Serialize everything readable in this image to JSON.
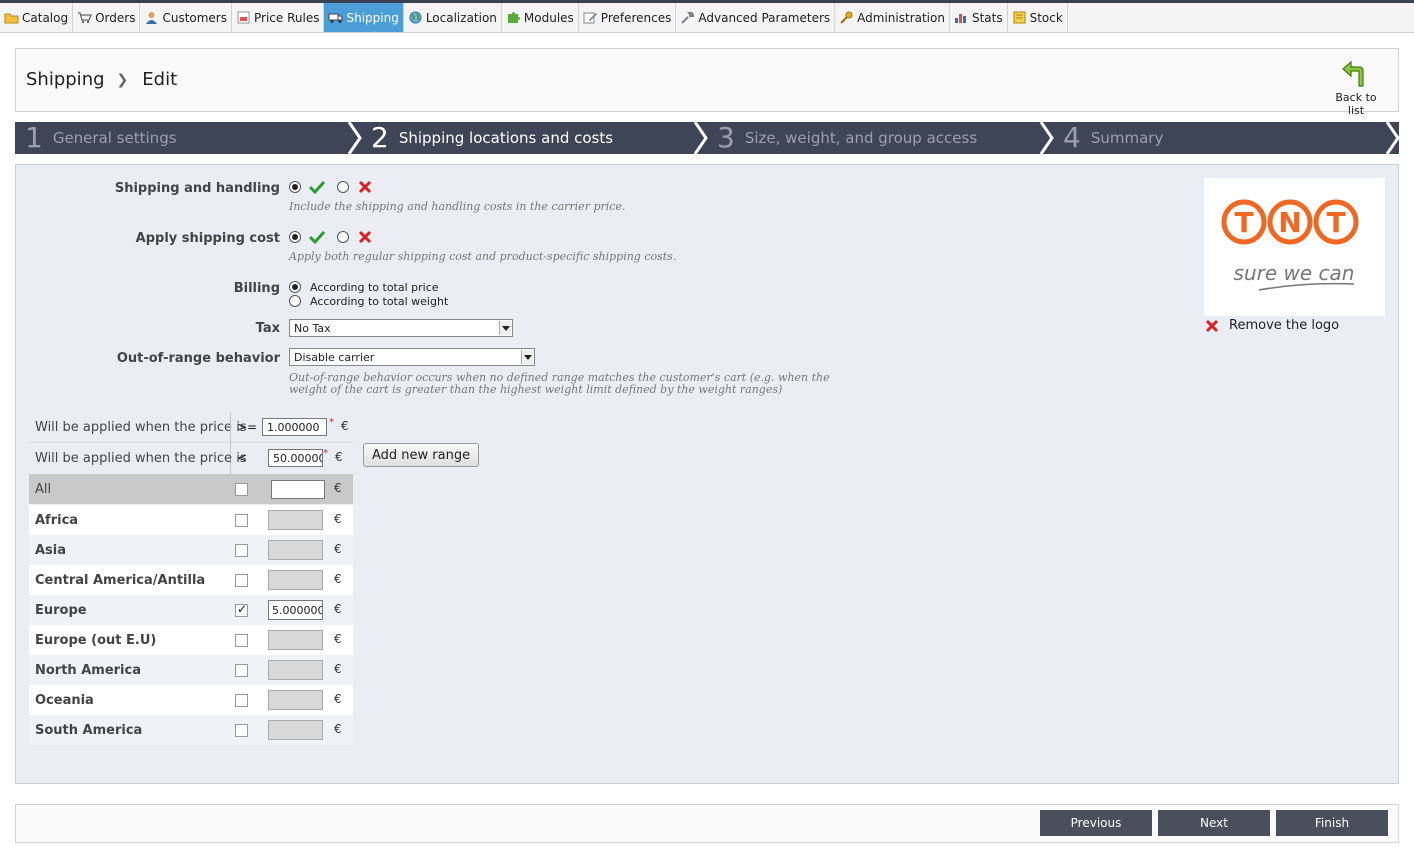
{
  "nav": [
    {
      "label": "Catalog",
      "icon": "folder-icon",
      "active": false
    },
    {
      "label": "Orders",
      "icon": "cart-icon",
      "active": false
    },
    {
      "label": "Customers",
      "icon": "person-icon",
      "active": false
    },
    {
      "label": "Price Rules",
      "icon": "price-tag-icon",
      "active": false
    },
    {
      "label": "Shipping",
      "icon": "truck-icon",
      "active": true
    },
    {
      "label": "Localization",
      "icon": "globe-icon",
      "active": false
    },
    {
      "label": "Modules",
      "icon": "puzzle-icon",
      "active": false
    },
    {
      "label": "Preferences",
      "icon": "edit-icon",
      "active": false
    },
    {
      "label": "Advanced Parameters",
      "icon": "wrench-icon",
      "active": false
    },
    {
      "label": "Administration",
      "icon": "key-icon",
      "active": false
    },
    {
      "label": "Stats",
      "icon": "bar-chart-icon",
      "active": false
    },
    {
      "label": "Stock",
      "icon": "stock-icon",
      "active": false
    }
  ],
  "header": {
    "crumb_section": "Shipping",
    "crumb_page": "Edit",
    "back_label": "Back to list"
  },
  "steps": [
    {
      "num": "1",
      "label": "General settings",
      "active": false
    },
    {
      "num": "2",
      "label": "Shipping locations and costs",
      "active": true
    },
    {
      "num": "3",
      "label": "Size, weight, and group access",
      "active": false
    },
    {
      "num": "4",
      "label": "Summary",
      "active": false
    }
  ],
  "form": {
    "shipping_handling": {
      "label": "Shipping and handling",
      "value": "yes",
      "help": "Include the shipping and handling costs in the carrier price."
    },
    "apply_shipping_cost": {
      "label": "Apply shipping cost",
      "value": "yes",
      "help": "Apply both regular shipping cost and product-specific shipping costs."
    },
    "billing": {
      "label": "Billing",
      "options": [
        "According to total price",
        "According to total weight"
      ],
      "selected": "According to total price"
    },
    "tax": {
      "label": "Tax",
      "value": "No Tax"
    },
    "out_of_range": {
      "label": "Out-of-range behavior",
      "value": "Disable carrier",
      "help_line1": "Out-of-range behavior occurs when no defined range matches the customer's cart (e.g. when the",
      "help_line2": "weight of the cart is greater than the highest weight limit defined by the weight ranges)"
    }
  },
  "logo": {
    "brand": "TNT",
    "tagline": "sure we can",
    "remove_label": "Remove the logo"
  },
  "ranges": {
    "row_label": "Will be applied when the price is",
    "op_from": ">=",
    "from_value": "1.000000",
    "op_to": "<",
    "to_value": "50.000000",
    "currency": "€",
    "add_button": "Add new range",
    "all_label": "All",
    "zones": [
      {
        "name": "Africa",
        "checked": false,
        "value": ""
      },
      {
        "name": "Asia",
        "checked": false,
        "value": ""
      },
      {
        "name": "Central America/Antilla",
        "checked": false,
        "value": ""
      },
      {
        "name": "Europe",
        "checked": true,
        "value": "5.000000"
      },
      {
        "name": "Europe (out E.U)",
        "checked": false,
        "value": ""
      },
      {
        "name": "North America",
        "checked": false,
        "value": ""
      },
      {
        "name": "Oceania",
        "checked": false,
        "value": ""
      },
      {
        "name": "South America",
        "checked": false,
        "value": ""
      }
    ]
  },
  "footer": {
    "previous": "Previous",
    "next": "Next",
    "finish": "Finish"
  },
  "colors": {
    "nav_active": "#4c9ed9",
    "steps_bg": "#3e4556",
    "panel_bg": "#ebedf4",
    "tnt_orange": "#f26722",
    "check_green": "#2e9b2e",
    "cross_red": "#e02020"
  }
}
